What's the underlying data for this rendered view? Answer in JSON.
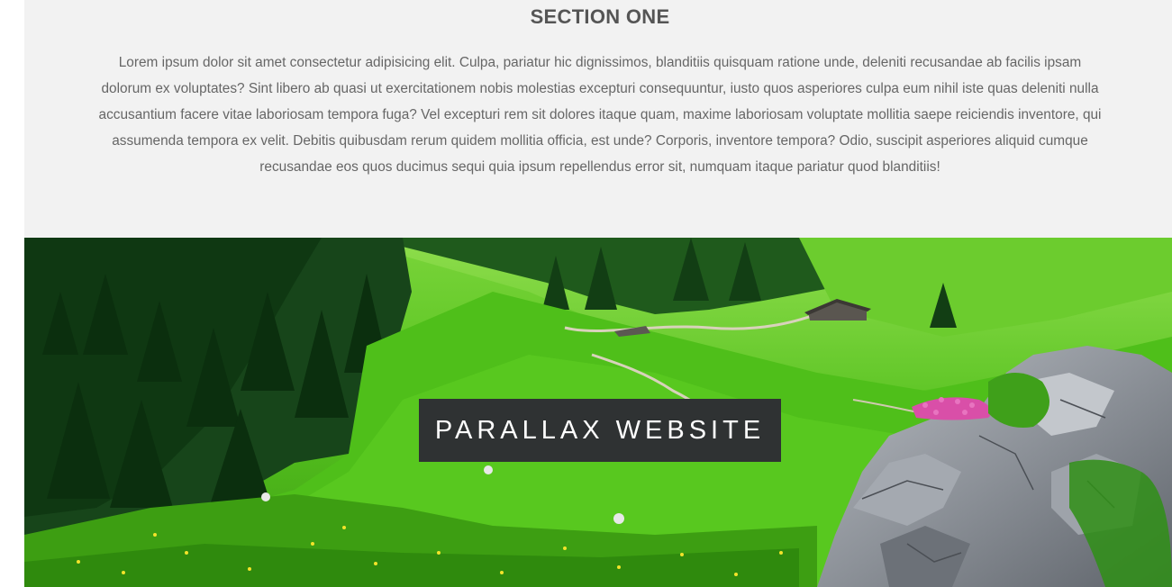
{
  "section_one": {
    "title": "SECTION ONE",
    "text": "Lorem ipsum dolor sit amet consectetur adipisicing elit. Culpa, pariatur hic dignissimos, blanditiis quisquam ratione unde, deleniti recusandae ab facilis ipsam dolorum ex voluptates? Sint libero ab quasi ut exercitationem nobis molestias excepturi consequuntur, iusto quos asperiores culpa eum nihil iste quas deleniti nulla accusantium facere vitae laboriosam tempora fuga? Vel excepturi rem sit dolores itaque quam, maxime laboriosam voluptate mollitia saepe reiciendis inventore, qui assumenda tempora ex velit. Debitis quibusdam rerum quidem mollitia officia, est unde? Corporis, inventore tempora? Odio, suscipit asperiores aliquid cumque recusandae eos quos ducimus sequi quia ipsum repellendus error sit, numquam itaque pariatur quod blanditiis!"
  },
  "hero": {
    "label": "PARALLAX WEBSITE",
    "image": "alpine-meadow-landscape"
  },
  "colors": {
    "section_background": "#f2f2f2",
    "title_color": "#555555",
    "text_color": "#666666",
    "label_background": "#2f3233",
    "label_text": "#ffffff"
  }
}
